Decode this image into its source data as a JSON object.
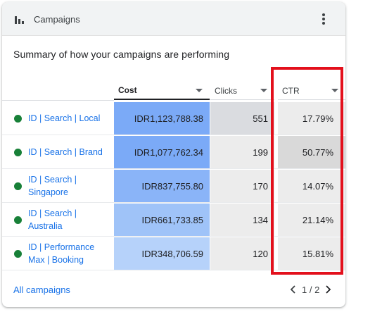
{
  "header": {
    "title": "Campaigns",
    "icon": "bar-chart-icon",
    "menu_icon": "more-vert-icon"
  },
  "summary": "Summary of how your campaigns are performing",
  "table": {
    "columns": [
      {
        "label": "Cost",
        "sorted": true
      },
      {
        "label": "Clicks",
        "sorted": false
      },
      {
        "label": "CTR",
        "sorted": false
      }
    ],
    "rows": [
      {
        "name": "ID | Search | Local",
        "status_color": "#188038",
        "cost": "IDR1,123,788.38",
        "clicks": "551",
        "ctr": "17.79%"
      },
      {
        "name": "ID | Search | Brand",
        "status_color": "#188038",
        "cost": "IDR1,077,762.34",
        "clicks": "199",
        "ctr": "50.77%"
      },
      {
        "name": "ID | Search | Singapore",
        "status_color": "#188038",
        "cost": "IDR837,755.80",
        "clicks": "170",
        "ctr": "14.07%"
      },
      {
        "name": "ID | Search | Australia",
        "status_color": "#188038",
        "cost": "IDR661,733.85",
        "clicks": "134",
        "ctr": "21.14%"
      },
      {
        "name": "ID | Performance Max | Booking",
        "status_color": "#188038",
        "cost": "IDR348,706.59",
        "clicks": "120",
        "ctr": "15.81%"
      }
    ],
    "heat_colors": {
      "cost": [
        "#7baaf7",
        "#7baaf7",
        "#8ab4f8",
        "#9fc3f8",
        "#b6d2fa"
      ],
      "clicks": [
        "#dadce0",
        "#ececec",
        "#ececec",
        "#ececec",
        "#ececec"
      ],
      "ctr": [
        "#ececec",
        "#d9d9d9",
        "#ececec",
        "#ececec",
        "#ececec"
      ]
    }
  },
  "footer": {
    "all_campaigns": "All campaigns",
    "page_current": "1",
    "page_total": "2",
    "page_label": "1 / 2"
  },
  "annotation": {
    "highlight_color": "#e3101c"
  }
}
